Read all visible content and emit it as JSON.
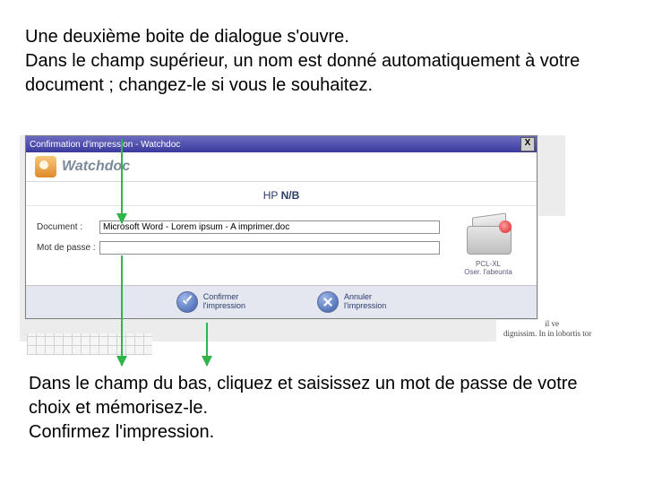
{
  "intro": {
    "p1": "Une deuxième boite de dialogue s'ouvre.",
    "p2": "Dans le champ supérieur, un nom est donné automatiquement à votre document ; changez-le si vous le souhaitez."
  },
  "dialog": {
    "title": "Confirmation d'impression - Watchdoc",
    "close_glyph": "X",
    "brand": "Watchdoc",
    "printer_prefix": "HP ",
    "printer_model": "N/B",
    "fields": {
      "document_label": "Document :",
      "document_value": "Microsoft Word - Lorem ipsum - A imprimer.doc",
      "password_label": "Mot de passe :",
      "password_value": ""
    },
    "printer_info": {
      "driver": "PCL-XL",
      "pages": "Oser. l'abeunta"
    },
    "buttons": {
      "confirm_l1": "Confirmer",
      "confirm_l2": "l'impression",
      "cancel_l1": "Annuler",
      "cancel_l2": "l'impression"
    }
  },
  "background_lorem": {
    "l1": "il ve",
    "l2": "dignissim. In in lobortis tor"
  },
  "outro": {
    "p1": "Dans le champ du bas, cliquez et saisissez un mot de passe de votre choix et mémorisez-le.",
    "p2": "Confirmez l'impression."
  }
}
